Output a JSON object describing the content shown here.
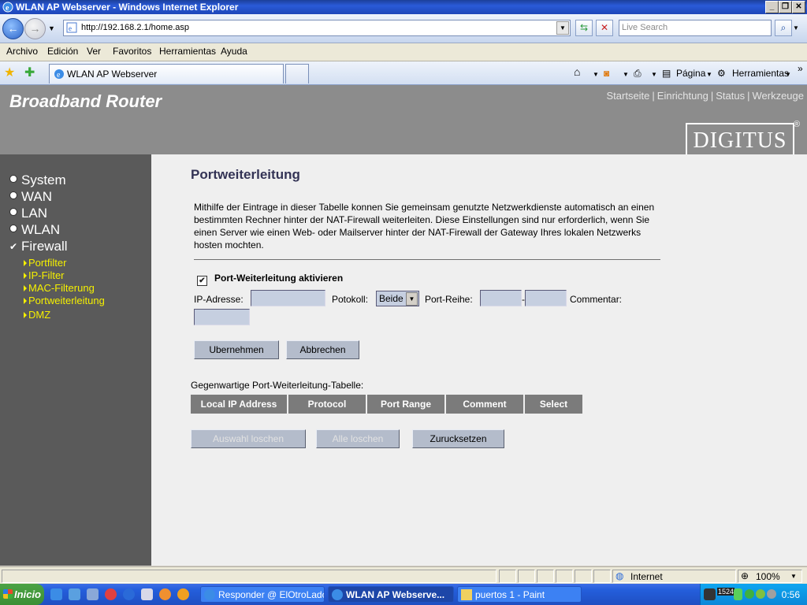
{
  "window": {
    "title": "WLAN AP Webserver - Windows Internet Explorer"
  },
  "browser": {
    "address": "http://192.168.2.1/home.asp",
    "search_placeholder": "Live Search",
    "menu": [
      "Archivo",
      "Edición",
      "Ver",
      "Favoritos",
      "Herramientas",
      "Ayuda"
    ],
    "tab_label": "WLAN AP Webserver",
    "cmd_page": "Página",
    "cmd_tools": "Herramientas"
  },
  "page": {
    "brand": "Broadband Router",
    "top_links": [
      "Startseite",
      "Einrichtung",
      "Status",
      "Werkzeuge"
    ],
    "logo": "DIGITUS",
    "logo_mark": "®",
    "nav": [
      "System",
      "WAN",
      "LAN",
      "WLAN",
      "Firewall"
    ],
    "subnav": [
      "Portfilter",
      "IP-Filter",
      "MAC-Filterung",
      "Portweiterleitung",
      "DMZ"
    ],
    "title": "Portweiterleitung",
    "description": "Mithilfe der Eintrage in dieser Tabelle konnen Sie gemeinsam genutzte Netzwerkdienste automatisch an einen bestimmten Rechner hinter der NAT-Firewall weiterleiten. Diese Einstellungen sind nur erforderlich, wenn Sie einen Server wie einen Web- oder Mailserver hinter der NAT-Firewall der Gateway Ihres lokalen Netzwerks hosten mochten.",
    "enable_label": "Port-Weiterleitung aktivieren",
    "enable_checked": true,
    "ip_label": "IP-Adresse:",
    "protocol_label": "Potokoll:",
    "protocol_value": "Beide",
    "port_label": "Port-Reihe:",
    "port_dash": "-",
    "comment_label": "Commentar:",
    "apply_button": "Ubernehmen",
    "cancel_button": "Abbrechen",
    "table_label": "Gegenwartige Port-Weiterleitung-Tabelle:",
    "table_headers": [
      "Local IP Address",
      "Protocol",
      "Port Range",
      "Comment",
      "Select"
    ],
    "delete_selected_button": "Auswahl loschen",
    "delete_all_button": "Alle loschen",
    "reset_button": "Zurucksetzen"
  },
  "statusbar": {
    "zone": "Internet",
    "zoom": "100%"
  },
  "taskbar": {
    "start": "Inicio",
    "tasks": [
      "Responder @ ElOtroLado...",
      "WLAN AP Webserve...",
      "puertos 1 - Paint"
    ],
    "tray_badge": "1524",
    "clock": "0:56"
  },
  "colors": {
    "sidebar": "#5a5a5a",
    "header": "#8c8c8c",
    "subnav": "#f5f000",
    "table_header": "#7b7b7b",
    "content_bg": "#efefef"
  }
}
